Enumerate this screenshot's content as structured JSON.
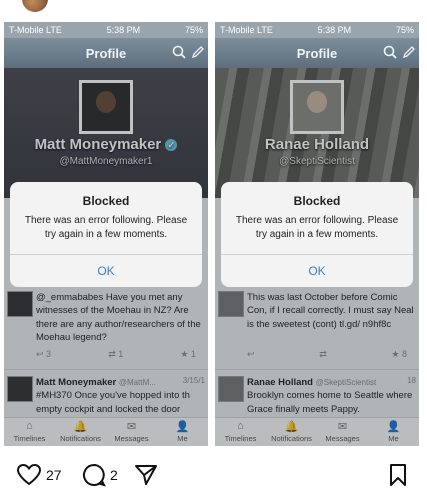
{
  "phones": [
    {
      "status": {
        "carrier": "T-Mobile",
        "network": "LTE",
        "time": "5:38 PM",
        "battery": "75%"
      },
      "nav_title": "Profile",
      "hero": {
        "name": "Matt Moneymaker",
        "handle": "@MattMoneymaker1"
      },
      "dialog": {
        "title": "Blocked",
        "message": "There was an error following. Please try again in a few moments.",
        "ok": "OK"
      },
      "tweet1": {
        "text": "@_emmababes Have you met any witnesses of the Moehau in NZ? Are there are any author/researchers of the Moehau legend?",
        "retweets": "3",
        "favorites": "1"
      },
      "tweet2": {
        "name": "Matt Moneymaker",
        "handle": "@MattM...",
        "time": "3/15/1",
        "text": "#MH370 Once you've hopped into th empty cockpit and locked the door"
      },
      "tabs": [
        "Timelines",
        "Notifications",
        "Messages",
        "Me"
      ]
    },
    {
      "status": {
        "carrier": "T-Mobile",
        "network": "LTE",
        "time": "5:38 PM",
        "battery": "75%"
      },
      "nav_title": "Profile",
      "hero": {
        "name": "Ranae Holland",
        "handle": "@SkeptiScientist"
      },
      "dialog": {
        "title": "Blocked",
        "message": "There was an error following. Please try again in a few moments.",
        "ok": "OK"
      },
      "tweet1": {
        "text": "This was last October before Comic Con, if I recall correctly. I must say Neal is the sweetest (cont) tl.gd/ n9hf8c",
        "retweets": "",
        "favorites": "8"
      },
      "tweet2": {
        "name": "Ranae Holland",
        "handle": "@SkeptiScientist",
        "time": "18",
        "text": "Brooklyn comes home to Seattle where Grace finally meets Pappy."
      },
      "tabs": [
        "Timelines",
        "Notifications",
        "Messages",
        "Me"
      ]
    }
  ],
  "post_actions": {
    "likes": "27",
    "comments": "2"
  }
}
